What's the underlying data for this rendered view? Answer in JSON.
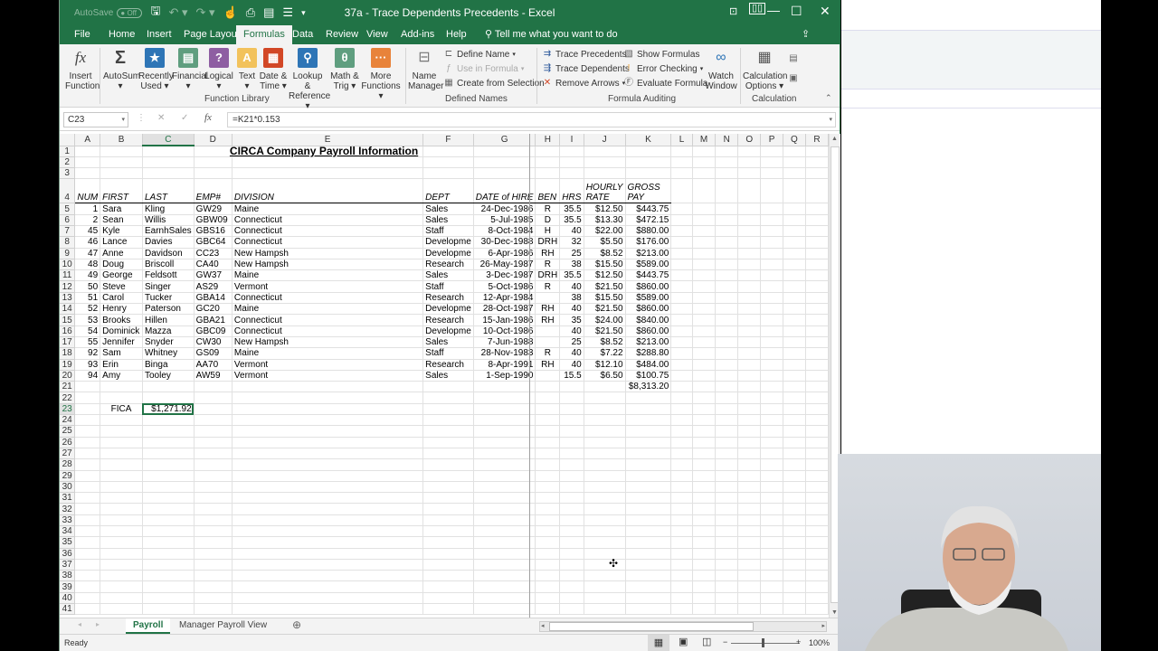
{
  "window": {
    "title": "37a - Trace Dependents Precedents  -  Excel",
    "autosave_label": "AutoSave",
    "autosave_state": "Off",
    "controls": [
      "ribbon-display-options",
      "minimize",
      "maximize",
      "close"
    ]
  },
  "tabs": [
    {
      "label": "File"
    },
    {
      "label": "Home"
    },
    {
      "label": "Insert"
    },
    {
      "label": "Page Layout"
    },
    {
      "label": "Formulas",
      "active": true
    },
    {
      "label": "Data"
    },
    {
      "label": "Review"
    },
    {
      "label": "View"
    },
    {
      "label": "Add-ins"
    },
    {
      "label": "Help"
    }
  ],
  "tell_me": "Tell me what you want to do",
  "share_label": "Share",
  "ribbon": {
    "function_library": {
      "label": "Function Library",
      "buttons": [
        {
          "label1": "Insert",
          "label2": "Function",
          "icon": "fx-icon"
        },
        {
          "label1": "AutoSum",
          "label2": "▾",
          "icon": "sigma-icon"
        },
        {
          "label1": "Recently",
          "label2": "Used ▾",
          "icon": "star-book-icon"
        },
        {
          "label1": "Financial",
          "label2": "▾",
          "icon": "financial-book-icon"
        },
        {
          "label1": "Logical",
          "label2": "▾",
          "icon": "question-book-icon"
        },
        {
          "label1": "Text",
          "label2": "▾",
          "icon": "text-book-icon"
        },
        {
          "label1": "Date &",
          "label2": "Time ▾",
          "icon": "calendar-book-icon"
        },
        {
          "label1": "Lookup &",
          "label2": "Reference ▾",
          "icon": "magnifier-book-icon"
        },
        {
          "label1": "Math &",
          "label2": "Trig ▾",
          "icon": "theta-book-icon"
        },
        {
          "label1": "More",
          "label2": "Functions ▾",
          "icon": "more-book-icon"
        }
      ]
    },
    "defined_names": {
      "label": "Defined Names",
      "name_manager": {
        "label1": "Name",
        "label2": "Manager"
      },
      "define_name": "Define Name",
      "use_in_formula": "Use in Formula",
      "create_from_selection": "Create from Selection"
    },
    "formula_auditing": {
      "label": "Formula Auditing",
      "trace_precedents": "Trace Precedents",
      "trace_dependents": "Trace Dependents",
      "remove_arrows": "Remove Arrows",
      "show_formulas": "Show Formulas",
      "error_checking": "Error Checking",
      "evaluate_formula": "Evaluate Formula",
      "watch_window": {
        "label1": "Watch",
        "label2": "Window"
      }
    },
    "calculation": {
      "label": "Calculation",
      "options": {
        "label1": "Calculation",
        "label2": "Options ▾"
      }
    }
  },
  "formula_bar": {
    "name_box": "C23",
    "formula": "=K21*0.153"
  },
  "columns": [
    "A",
    "B",
    "C",
    "D",
    "E",
    "F",
    "G",
    "H",
    "I",
    "J",
    "K",
    "L",
    "M",
    "N",
    "O",
    "P",
    "Q",
    "R"
  ],
  "sheet": {
    "title": "CIRCA Company Payroll Information",
    "headers": {
      "num": "NUM",
      "first": "FIRST",
      "last": "LAST",
      "emp": "EMP#",
      "division": "DIVISION",
      "dept": "DEPT",
      "hire": "DATE of HIRE",
      "ben": "BEN",
      "hrs": "HRS",
      "rate_1": "HOURLY",
      "rate_2": "RATE",
      "gross_1": "GROSS",
      "gross_2": "PAY"
    },
    "rows": [
      [
        "1",
        "Sara",
        "Kling",
        "GW29",
        "Maine",
        "Sales",
        "24-Dec-1986",
        "R",
        "35.5",
        "$12.50",
        "$443.75"
      ],
      [
        "2",
        "Sean",
        "Willis",
        "GBW09",
        "Connecticut",
        "Sales",
        "5-Jul-1985",
        "D",
        "35.5",
        "$13.30",
        "$472.15"
      ],
      [
        "45",
        "Kyle",
        "EarnhSales",
        "GBS16",
        "Connecticut",
        "Staff",
        "8-Oct-1984",
        "H",
        "40",
        "$22.00",
        "$880.00"
      ],
      [
        "46",
        "Lance",
        "Davies",
        "GBC64",
        "Connecticut",
        "Developme",
        "30-Dec-1988",
        "DRH",
        "32",
        "$5.50",
        "$176.00"
      ],
      [
        "47",
        "Anne",
        "Davidson",
        "CC23",
        "New Hampsh",
        "Developme",
        "6-Apr-1986",
        "RH",
        "25",
        "$8.52",
        "$213.00"
      ],
      [
        "48",
        "Doug",
        "Briscoll",
        "CA40",
        "New Hampsh",
        "Research",
        "26-May-1987",
        "R",
        "38",
        "$15.50",
        "$589.00"
      ],
      [
        "49",
        "George",
        "Feldsott",
        "GW37",
        "Maine",
        "Sales",
        "3-Dec-1987",
        "DRH",
        "35.5",
        "$12.50",
        "$443.75"
      ],
      [
        "50",
        "Steve",
        "Singer",
        "AS29",
        "Vermont",
        "Staff",
        "5-Oct-1986",
        "R",
        "40",
        "$21.50",
        "$860.00"
      ],
      [
        "51",
        "Carol",
        "Tucker",
        "GBA14",
        "Connecticut",
        "Research",
        "12-Apr-1984",
        "",
        "38",
        "$15.50",
        "$589.00"
      ],
      [
        "52",
        "Henry",
        "Paterson",
        "GC20",
        "Maine",
        "Developme",
        "28-Oct-1987",
        "RH",
        "40",
        "$21.50",
        "$860.00"
      ],
      [
        "53",
        "Brooks",
        "Hillen",
        "GBA21",
        "Connecticut",
        "Research",
        "15-Jan-1986",
        "RH",
        "35",
        "$24.00",
        "$840.00"
      ],
      [
        "54",
        "Dominick",
        "Mazza",
        "GBC09",
        "Connecticut",
        "Developme",
        "10-Oct-1986",
        "",
        "40",
        "$21.50",
        "$860.00"
      ],
      [
        "55",
        "Jennifer",
        "Snyder",
        "CW30",
        "New Hampsh",
        "Sales",
        "7-Jun-1988",
        "",
        "25",
        "$8.52",
        "$213.00"
      ],
      [
        "92",
        "Sam",
        "Whitney",
        "GS09",
        "Maine",
        "Staff",
        "28-Nov-1983",
        "R",
        "40",
        "$7.22",
        "$288.80"
      ],
      [
        "93",
        "Erin",
        "Binga",
        "AA70",
        "Vermont",
        "Research",
        "8-Apr-1991",
        "RH",
        "40",
        "$12.10",
        "$484.00"
      ],
      [
        "94",
        "Amy",
        "Tooley",
        "AW59",
        "Vermont",
        "Sales",
        "1-Sep-1990",
        "",
        "15.5",
        "$6.50",
        "$100.75"
      ]
    ],
    "total_gross": "$8,313.20",
    "fica_label": "FICA",
    "fica_value": "$1,271.92",
    "last_row": 41
  },
  "sheet_tabs": [
    {
      "label": "Payroll",
      "active": true
    },
    {
      "label": "Manager Payroll View"
    }
  ],
  "status": {
    "ready": "Ready",
    "zoom": "100%"
  },
  "accent": "#217346"
}
